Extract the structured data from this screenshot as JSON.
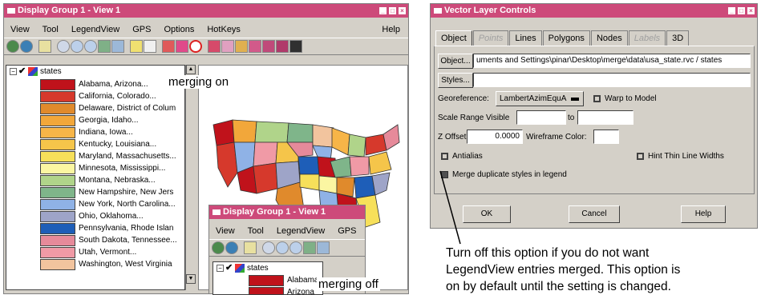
{
  "window1": {
    "title": "Display Group 1 - View 1",
    "menus": [
      "View",
      "Tool",
      "LegendView",
      "GPS",
      "Options",
      "HotKeys"
    ],
    "help": "Help",
    "tree_label": "states",
    "legend": [
      {
        "label": "Alabama, Arizona...",
        "color": "#c0121b"
      },
      {
        "label": "California, Colorado...",
        "color": "#d6392c"
      },
      {
        "label": "Delaware, District of Colum",
        "color": "#e08a2c"
      },
      {
        "label": "Georgia, Idaho...",
        "color": "#f2a73a"
      },
      {
        "label": "Indiana, Iowa...",
        "color": "#f7b548"
      },
      {
        "label": "Kentucky, Louisiana...",
        "color": "#f5c54a"
      },
      {
        "label": "Maryland, Massachusetts...",
        "color": "#f7e05a"
      },
      {
        "label": "Minnesota, Mississippi...",
        "color": "#fbf6a2"
      },
      {
        "label": "Montana, Nebraska...",
        "color": "#b0d48a"
      },
      {
        "label": "New Hampshire, New Jers",
        "color": "#7fb58a"
      },
      {
        "label": "New York, North Carolina...",
        "color": "#8fb2e6"
      },
      {
        "label": "Ohio, Oklahoma...",
        "color": "#9ea4c8"
      },
      {
        "label": "Pennsylvania, Rhode Islan",
        "color": "#1e5eb8"
      },
      {
        "label": "South Dakota, Tennessee...",
        "color": "#e68a9a"
      },
      {
        "label": "Utah, Vermont...",
        "color": "#f09aa6"
      },
      {
        "label": "Washington, West Virginia",
        "color": "#f2c49e"
      }
    ],
    "caption": "merging on"
  },
  "window2": {
    "title": "Display Group 1 - View 1",
    "menus": [
      "View",
      "Tool",
      "LegendView",
      "GPS"
    ],
    "tree_label": "states",
    "legend": [
      {
        "label": "Alabama",
        "color": "#c0121b"
      },
      {
        "label": "Arizona",
        "color": "#c0121b"
      }
    ],
    "caption": "merging off"
  },
  "vector": {
    "title": "Vector Layer Controls",
    "tabs": [
      {
        "label": "Object",
        "active": true,
        "disabled": false
      },
      {
        "label": "Points",
        "active": false,
        "disabled": true
      },
      {
        "label": "Lines",
        "active": false,
        "disabled": false
      },
      {
        "label": "Polygons",
        "active": false,
        "disabled": false
      },
      {
        "label": "Nodes",
        "active": false,
        "disabled": false
      },
      {
        "label": "Labels",
        "active": false,
        "disabled": true
      },
      {
        "label": "3D",
        "active": false,
        "disabled": false
      }
    ],
    "object_button": "Object...",
    "object_path": "uments and Settings\\pinar\\Desktop\\merge\\data\\usa_state.rvc / states",
    "styles_button": "Styles...",
    "georeference_label": "Georeference:",
    "georeference_value": "LambertAzimEquA",
    "warp_label": "Warp to Model",
    "scale_label": "Scale Range Visible",
    "to_label": "to",
    "zoffset_label": "Z Offset",
    "zoffset_value": "0.0000",
    "wireframe_label": "Wireframe Color:",
    "antialias_label": "Antialias",
    "hint_label": "Hint Thin Line Widths",
    "merge_label": "Merge duplicate styles in legend",
    "ok": "OK",
    "cancel": "Cancel",
    "help": "Help"
  },
  "note": {
    "line1": "Turn off this option if you do not want",
    "line2": "LegendView entries merged. This option is",
    "line3": "on by default until the setting is changed."
  },
  "colors": {
    "titlebar": "#cd4a7a",
    "dialog": "#d4d0c8"
  }
}
